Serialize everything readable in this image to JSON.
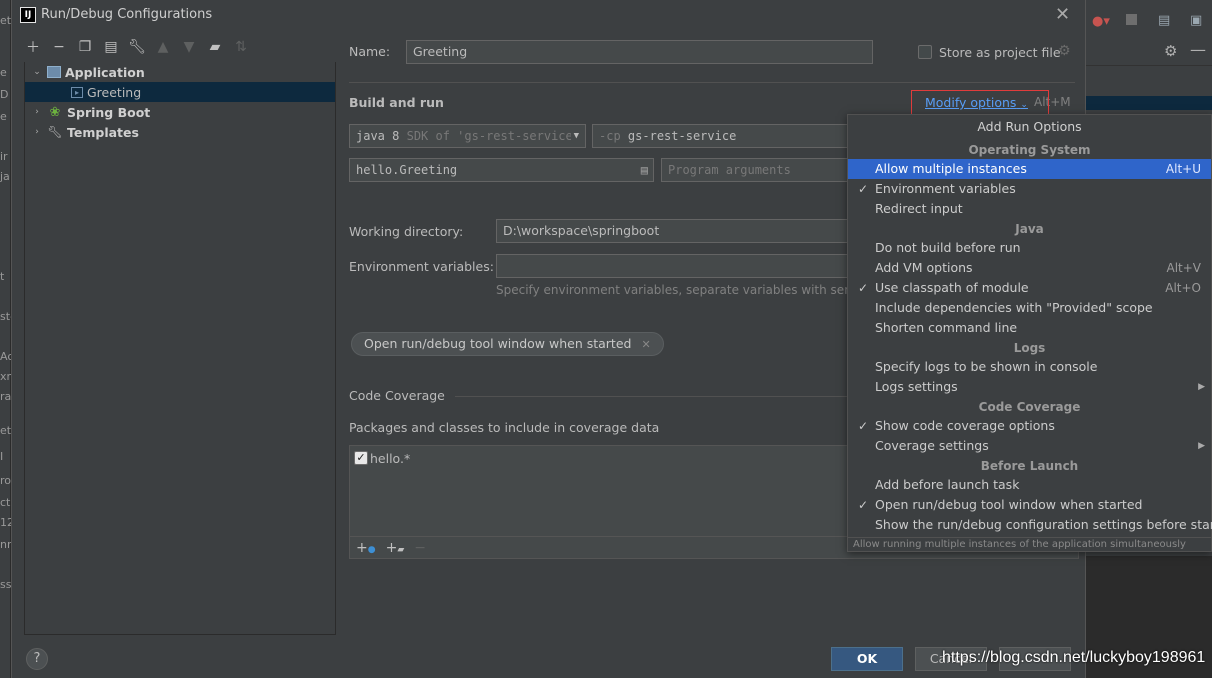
{
  "window": {
    "title": "Run/Debug Configurations",
    "logo": "IJ"
  },
  "ide_fragments": [
    "et",
    "e",
    "D",
    "e [",
    "ir",
    "ja",
    "t",
    "st-",
    "Ac",
    "xm",
    "ra",
    "eti",
    "I",
    "ro",
    "ct",
    "12",
    "nr",
    "ss"
  ],
  "tree": {
    "items": [
      {
        "label": "Application",
        "expanded": true
      },
      {
        "label": "Greeting",
        "selected": true
      },
      {
        "label": "Spring Boot",
        "expanded": false
      },
      {
        "label": "Templates",
        "expanded": false
      }
    ]
  },
  "form": {
    "name_label": "Name:",
    "name_value": "Greeting",
    "store_label": "Store as project file",
    "build_run_label": "Build and run",
    "modify_options": "Modify options",
    "modify_shortcut": "Alt+M",
    "jre_value": "java 8",
    "jre_hint": "SDK of 'gs-rest-service",
    "cp_prefix": "-cp",
    "cp_value": "gs-rest-service",
    "main_class": "hello.Greeting",
    "program_args_placeholder": "Program arguments",
    "workdir_label": "Working directory:",
    "workdir_value": "D:\\workspace\\springboot",
    "env_label": "Environment variables:",
    "env_hint": "Specify environment variables, separate variables with semic",
    "pill_label": "Open run/debug tool window when started",
    "coverage_label": "Code Coverage",
    "packages_label": "Packages and classes to include in coverage data",
    "coverage_entry": "hello.*"
  },
  "popup": {
    "title": "Add Run Options",
    "groups": {
      "os": "Operating System",
      "java": "Java",
      "logs": "Logs",
      "coverage": "Code Coverage",
      "before": "Before Launch"
    },
    "items": [
      {
        "label": "Allow multiple instances",
        "shortcut": "Alt+U",
        "checked": false
      },
      {
        "label": "Environment variables",
        "checked": true
      },
      {
        "label": "Redirect input",
        "checked": false
      },
      {
        "label": "Do not build before run",
        "checked": false
      },
      {
        "label": "Add VM options",
        "shortcut": "Alt+V",
        "checked": false
      },
      {
        "label": "Use classpath of module",
        "shortcut": "Alt+O",
        "checked": true
      },
      {
        "label": "Include dependencies with \"Provided\" scope",
        "checked": false
      },
      {
        "label": "Shorten command line",
        "checked": false
      },
      {
        "label": "Specify logs to be shown in console",
        "checked": false
      },
      {
        "label": "Logs settings",
        "checked": false,
        "submenu": true
      },
      {
        "label": "Show code coverage options",
        "checked": true
      },
      {
        "label": "Coverage settings",
        "checked": false,
        "submenu": true
      },
      {
        "label": "Add before launch task",
        "checked": false
      },
      {
        "label": "Open run/debug tool window when started",
        "checked": true
      },
      {
        "label": "Show the run/debug configuration settings before start",
        "checked": false
      }
    ],
    "footer": "Allow running multiple instances of the application simultaneously",
    "check_glyph": "✓"
  },
  "buttons": {
    "ok": "OK",
    "cancel": "Cancel",
    "help": "?"
  },
  "watermark": "https://blog.csdn.net/luckyboy198961",
  "colors": {
    "accent": "#589df6",
    "selection": "#2f65ca",
    "highlight": "#e03c3c",
    "ok": "#365880"
  }
}
